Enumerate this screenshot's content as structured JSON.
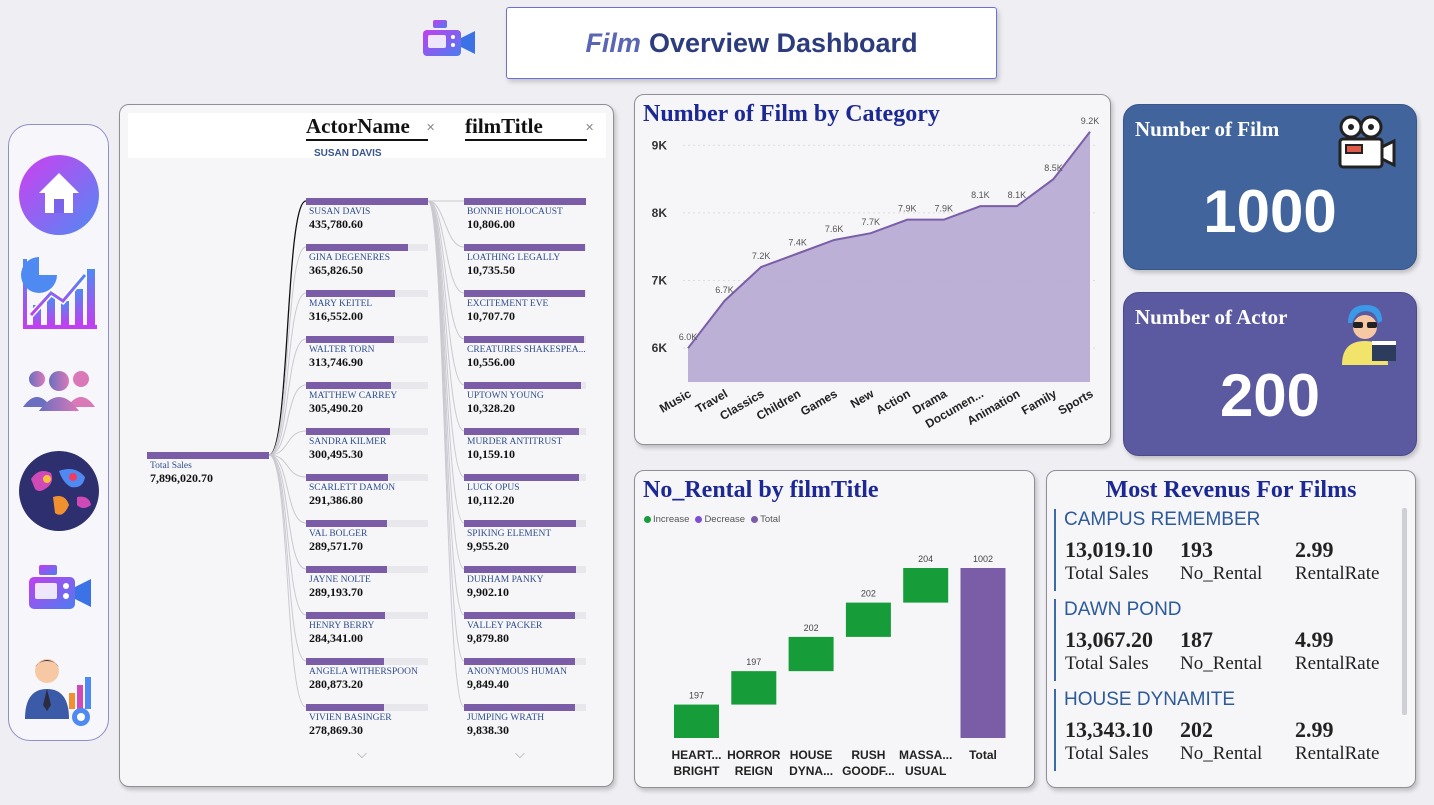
{
  "header": {
    "title_em": "Film",
    "title_rest": "Overview Dashboard"
  },
  "nav": {
    "items": [
      "home-icon",
      "analytics-chart-icon",
      "people-icon",
      "world-map-icon",
      "film-camera-icon",
      "manager-report-icon"
    ]
  },
  "tree": {
    "col1_header": "ActorName",
    "col2_header": "filmTitle",
    "selected_actor": "SUSAN DAVIS",
    "root": {
      "label": "Total Sales",
      "value": "7,896,020.70"
    },
    "actors": [
      {
        "name": "SUSAN DAVIS",
        "value": "435,780.60",
        "frac": 1.0
      },
      {
        "name": "GINA DEGENERES",
        "value": "365,826.50",
        "frac": 0.84
      },
      {
        "name": "MARY KEITEL",
        "value": "316,552.00",
        "frac": 0.73
      },
      {
        "name": "WALTER TORN",
        "value": "313,746.90",
        "frac": 0.72
      },
      {
        "name": "MATTHEW CARREY",
        "value": "305,490.20",
        "frac": 0.7
      },
      {
        "name": "SANDRA KILMER",
        "value": "300,495.30",
        "frac": 0.69
      },
      {
        "name": "SCARLETT DAMON",
        "value": "291,386.80",
        "frac": 0.67
      },
      {
        "name": "VAL BOLGER",
        "value": "289,571.70",
        "frac": 0.66
      },
      {
        "name": "JAYNE NOLTE",
        "value": "289,193.70",
        "frac": 0.66
      },
      {
        "name": "HENRY BERRY",
        "value": "284,341.00",
        "frac": 0.65
      },
      {
        "name": "ANGELA WITHERSPOON",
        "value": "280,873.20",
        "frac": 0.64
      },
      {
        "name": "VIVIEN BASINGER",
        "value": "278,869.30",
        "frac": 0.64
      }
    ],
    "films": [
      {
        "name": "BONNIE HOLOCAUST",
        "value": "10,806.00",
        "frac": 1.0
      },
      {
        "name": "LOATHING LEGALLY",
        "value": "10,735.50",
        "frac": 0.99
      },
      {
        "name": "EXCITEMENT EVE",
        "value": "10,707.70",
        "frac": 0.99
      },
      {
        "name": "CREATURES SHAKESPEA...",
        "value": "10,556.00",
        "frac": 0.98
      },
      {
        "name": "UPTOWN YOUNG",
        "value": "10,328.20",
        "frac": 0.96
      },
      {
        "name": "MURDER ANTITRUST",
        "value": "10,159.10",
        "frac": 0.94
      },
      {
        "name": "LUCK OPUS",
        "value": "10,112.20",
        "frac": 0.94
      },
      {
        "name": "SPIKING ELEMENT",
        "value": "9,955.20",
        "frac": 0.92
      },
      {
        "name": "DURHAM PANKY",
        "value": "9,902.10",
        "frac": 0.92
      },
      {
        "name": "VALLEY PACKER",
        "value": "9,879.80",
        "frac": 0.91
      },
      {
        "name": "ANONYMOUS HUMAN",
        "value": "9,849.40",
        "frac": 0.91
      },
      {
        "name": "JUMPING WRATH",
        "value": "9,838.30",
        "frac": 0.91
      }
    ]
  },
  "kpis": {
    "film": {
      "label": "Number of Film",
      "value": "1000"
    },
    "actor": {
      "label": "Number of Actor",
      "value": "200"
    }
  },
  "chart_data": [
    {
      "type": "area",
      "title": "Number of Film by Category",
      "categories": [
        "Music",
        "Travel",
        "Classics",
        "Children",
        "Games",
        "New",
        "Action",
        "Drama",
        "Documen...",
        "Animation",
        "Family",
        "Sports"
      ],
      "values": [
        6.0,
        6.7,
        7.2,
        7.4,
        7.6,
        7.7,
        7.9,
        7.9,
        8.1,
        8.1,
        8.5,
        9.2
      ],
      "data_labels": [
        "6.0K",
        "6.7K",
        "7.2K",
        "7.4K",
        "7.6K",
        "7.7K",
        "7.9K",
        "7.9K",
        "8.1K",
        "8.1K",
        "8.5K",
        "9.2K"
      ],
      "y_ticks": [
        "6K",
        "7K",
        "8K",
        "9K"
      ],
      "ylim": [
        5.5,
        9.3
      ],
      "color": "#7a5ea8",
      "fill": "#b7a8d2"
    },
    {
      "type": "bar",
      "subtype": "waterfall",
      "title": "No_Rental by filmTitle",
      "legend": [
        "Increase",
        "Decrease",
        "Total"
      ],
      "legend_colors": [
        "#169c38",
        "#7b4fd0",
        "#7b5ca6"
      ],
      "categories": [
        [
          "HEART...",
          "BRIGHT"
        ],
        [
          "HORROR",
          "REIGN"
        ],
        [
          "HOUSE",
          "DYNA..."
        ],
        [
          "RUSH",
          "GOODF..."
        ],
        [
          "MASSA...",
          "USUAL"
        ],
        [
          "Total"
        ]
      ],
      "values": [
        197,
        197,
        202,
        202,
        204,
        1002
      ],
      "is_total": [
        false,
        false,
        false,
        false,
        false,
        true
      ],
      "increase_color": "#169c38",
      "total_color": "#7b5ca6"
    }
  ],
  "revenue": {
    "title": "Most Revenus For Films",
    "labels": {
      "sales": "Total Sales",
      "rental": "No_Rental",
      "rate": "RentalRate"
    },
    "films": [
      {
        "name": "CAMPUS REMEMBER",
        "sales": "13,019.10",
        "rental": "193",
        "rate": "2.99"
      },
      {
        "name": "DAWN POND",
        "sales": "13,067.20",
        "rental": "187",
        "rate": "4.99"
      },
      {
        "name": "HOUSE DYNAMITE",
        "sales": "13,343.10",
        "rental": "202",
        "rate": "2.99"
      }
    ]
  }
}
